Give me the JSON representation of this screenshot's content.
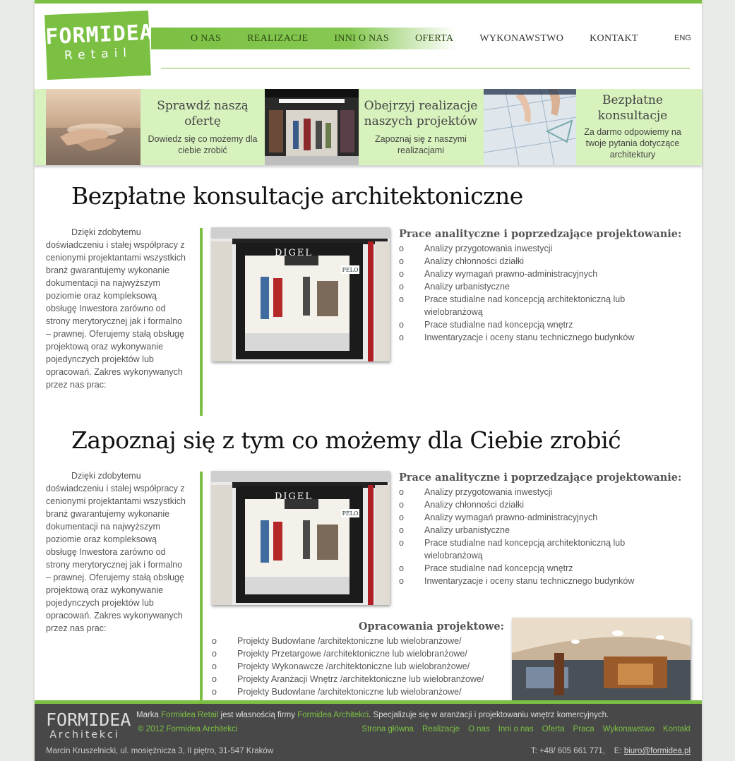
{
  "brand": {
    "logo_top": "FORMIDEA",
    "logo_bottom": "Retail"
  },
  "nav": {
    "items": [
      "O NAS",
      "REALIZACJE",
      "INNI O NAS",
      "OFERTA",
      "WYKONAWSTWO",
      "KONTAKT"
    ],
    "lang": "ENG"
  },
  "promo": [
    {
      "title": "Sprawdź naszą ofertę",
      "desc": "Dowiedz się co możemy dla ciebie zrobić"
    },
    {
      "title": "Obejrzyj realizacje naszych projektów",
      "desc": "Zapoznaj się z naszymi realizacjami"
    },
    {
      "title": "Bezpłatne konsultacje",
      "desc": "Za darmo odpowiemy na twoje pytania dotyczące architektury"
    }
  ],
  "sections": [
    {
      "heading": "Bezpłatne konsultacje architektoniczne",
      "intro": "Dzięki zdobytemu doświadczeniu i stałej współpracy z cenionymi projektantami wszystkich branż gwarantujemy wykonanie dokumentacji na najwyższym poziomie oraz kompleksową obsługę Inwestora zarówno od strony merytorycznej jak i formalno – prawnej.",
      "intro2": "Oferujemy stałą obsługę projektową oraz wykonywanie pojedynczych projektów lub opracowań.",
      "intro3": "Zakres wykonywanych przez nas prac:",
      "store_sign": "DIGEL",
      "store_sign2": "PELO",
      "list_title": "Prace analityczne i poprzedzające projektowanie:",
      "list": [
        "Analizy przygotowania inwestycji",
        "Analizy chłonności działki",
        "Analizy wymagań prawno-administracyjnych",
        "Analizy urbanistyczne",
        "Prace studialne nad koncepcją architektoniczną lub wielobranżową",
        "Prace studialne nad koncepcją wnętrz",
        "Inwentaryzacje i oceny stanu technicznego budynków"
      ]
    },
    {
      "heading": "Zapoznaj się z tym co możemy dla Ciebie zrobić",
      "intro": "Dzięki zdobytemu doświadczeniu i stałej współpracy z cenionymi projektantami wszystkich branż gwarantujemy wykonanie dokumentacji na najwyższym poziomie oraz kompleksową obsługę Inwestora zarówno od strony merytorycznej jak i formalno – prawnej.",
      "intro2": "Oferujemy stałą obsługę projektową oraz wykonywanie pojedynczych projektów lub opracowań.",
      "intro3": "Zakres wykonywanych przez nas prac:",
      "store_sign": "DIGEL",
      "store_sign2": "PELO",
      "list_title": "Prace analityczne i poprzedzające projektowanie:",
      "list": [
        "Analizy przygotowania inwestycji",
        "Analizy chłonności działki",
        "Analizy wymagań prawno-administracyjnych",
        "Analizy urbanistyczne",
        "Prace studialne nad koncepcją architektoniczną lub wielobranżową",
        "Prace studialne nad koncepcją wnętrz",
        "Inwentaryzacje i oceny stanu technicznego budynków"
      ],
      "list2_title": "Opracowania projektowe:",
      "list2": [
        "Projekty Budowlane /architektoniczne lub wielobranżowe/",
        "Projekty Przetargowe /architektoniczne lub wielobranżowe/",
        "Projekty Wykonawcze /architektoniczne lub wielobranżowe/",
        "Projekty Aranżacji Wnętrz /architektoniczne lub wielobranżowe/",
        "Projekty Budowlane /architektoniczne lub wielobranżowe/"
      ]
    }
  ],
  "footer": {
    "logo_top": "FORMIDEA",
    "logo_bottom": "Architekci",
    "line_a": "Marka ",
    "brand_retail": "Formidea Retail",
    "line_b": " jest własnością firmy ",
    "brand_arch": "Formidea Architekci",
    "line_c": ". Specjalizuje się w aranżacji i projektowaniu wnętrz komercyjnych.",
    "copyright": "© 2012 Formidea Architekci",
    "links": [
      "Strona główna",
      "Realizacje",
      "O nas",
      "Inni o nas",
      "Oferta",
      "Praca",
      "Wykonawstwo",
      "Kontakt"
    ],
    "address": "Marcin Kruszelnicki, ul. mosiężnicza 3, II piętro, 31-547 Kraków",
    "phone": "T: +48/ 605 661 771,",
    "email_label": "E:",
    "email": "biuro@formidea.pl"
  },
  "colors": {
    "accent": "#7bc043",
    "promo_bg": "#d7f2bd",
    "footer_bg": "#484848"
  }
}
